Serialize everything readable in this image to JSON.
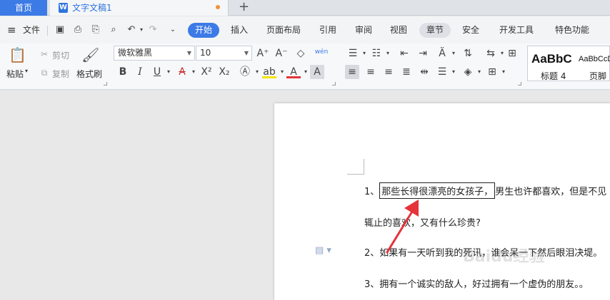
{
  "tabs": {
    "home": "首页",
    "doc_icon": "W",
    "doc_title": "文字文稿1",
    "new_tab": "+"
  },
  "menubar": {
    "menu_icon": "≡",
    "file": "文件",
    "tabs": [
      "开始",
      "插入",
      "页面布局",
      "引用",
      "审阅",
      "视图",
      "章节",
      "安全",
      "开发工具",
      "特色功能"
    ],
    "active_tab": "开始"
  },
  "ribbon": {
    "paste": "粘贴",
    "cut": "剪切",
    "copy": "复制",
    "format_painter": "格式刷",
    "font_name": "微软雅黑",
    "font_size": "10",
    "pinyin": "wén",
    "style_preview_big": "AaBbC",
    "style_preview_small": "AaBbCcDd",
    "style_label_1": "标题 4",
    "style_label_2": "页脚"
  },
  "document": {
    "para1_prefix": "1、",
    "para1_highlight": "那些长得很漂亮的女孩子，",
    "para1_rest": "男生也许都喜欢，但是不见",
    "para1_line2": "辄止的喜欢，又有什么珍贵?",
    "para2": "2、如果有一天听到我的死讯，谁会呆一下然后眼泪决堤。",
    "para3": "3、拥有一个诚实的敌人，好过拥有一个虚伪的朋友。。"
  },
  "watermark": "Baidu经验",
  "colors": {
    "accent": "#3c7ae6",
    "arrow": "#e5333a"
  }
}
